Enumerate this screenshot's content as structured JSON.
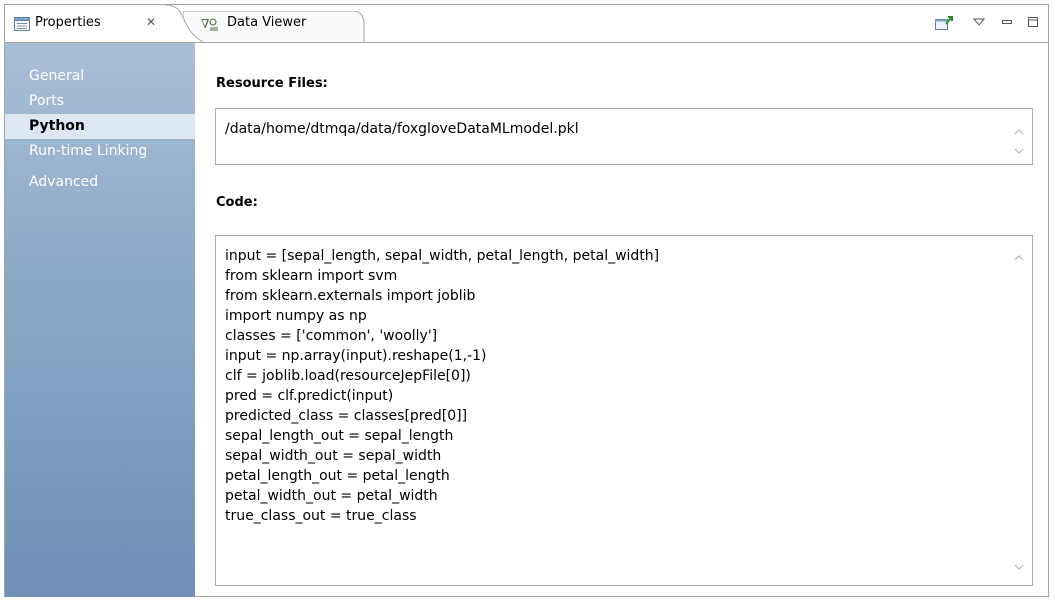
{
  "tabs": [
    {
      "label": "Properties",
      "icon": "properties-view-icon",
      "closable": true,
      "active": true
    },
    {
      "label": "Data Viewer",
      "icon": "data-viewer-icon",
      "active": false
    }
  ],
  "tab_close_glyph": "✕",
  "view_toolbar": {
    "icons": [
      "pin-view-icon",
      "view-menu-icon",
      "minimize-icon",
      "maximize-icon"
    ]
  },
  "sidebar": {
    "items": [
      {
        "label": "General",
        "selected": false
      },
      {
        "label": "Ports",
        "selected": false
      },
      {
        "label": "Python",
        "selected": true
      },
      {
        "label": "Run-time Linking",
        "selected": false
      },
      {
        "label": "Advanced",
        "selected": false
      }
    ]
  },
  "resource_files": {
    "label": "Resource Files:",
    "value": "/data/home/dtmqa/data/foxgloveDataMLmodel.pkl"
  },
  "code": {
    "label": "Code:",
    "lines": [
      "input = [sepal_length, sepal_width, petal_length, petal_width]",
      "from sklearn import svm",
      "from sklearn.externals import joblib",
      "import numpy as np",
      "classes = ['common', 'woolly']",
      "input = np.array(input).reshape(1,-1)",
      "clf = joblib.load(resourceJepFile[0])",
      "pred = clf.predict(input)",
      "predicted_class = classes[pred[0]]",
      "sepal_length_out = sepal_length",
      "sepal_width_out = sepal_width",
      "petal_length_out = petal_length",
      "petal_width_out = petal_width",
      "true_class_out = true_class"
    ]
  },
  "colors": {
    "nav_top": "#a9bfd6",
    "nav_bottom": "#6f8fb5",
    "nav_selected": "#dde7f1",
    "border": "#a9a9a9"
  }
}
